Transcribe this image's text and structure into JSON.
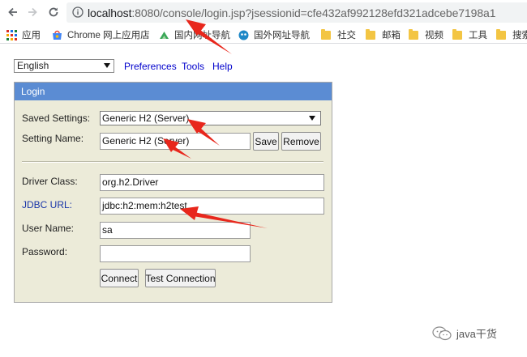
{
  "browser": {
    "url_host": "localhost",
    "url_rest": ":8080/console/login.jsp?jsessionid=cfe432af992128efd321adcebe7198a1",
    "bookmarks": [
      {
        "label": "应用",
        "icon": "apps-grid-icon"
      },
      {
        "label": "Chrome 网上应用店",
        "icon": "chrome-webstore-icon"
      },
      {
        "label": "国内网址导航",
        "icon": "navigation-site-icon"
      },
      {
        "label": "国外网址导航",
        "icon": "globe-site-icon"
      },
      {
        "label": "社交",
        "icon": "folder-icon"
      },
      {
        "label": "邮箱",
        "icon": "folder-icon"
      },
      {
        "label": "视频",
        "icon": "folder-icon"
      },
      {
        "label": "工具",
        "icon": "folder-icon"
      },
      {
        "label": "搜索",
        "icon": "folder-icon"
      }
    ]
  },
  "top": {
    "language": "English",
    "links": [
      "Preferences",
      "Tools",
      "Help"
    ]
  },
  "login": {
    "title": "Login",
    "saved_settings_label": "Saved Settings:",
    "saved_settings_value": "Generic H2 (Server)",
    "setting_name_label": "Setting Name:",
    "setting_name_value": "Generic H2 (Server)",
    "save_button": "Save",
    "remove_button": "Remove",
    "driver_class_label": "Driver Class:",
    "driver_class_value": "org.h2.Driver",
    "jdbc_url_label": "JDBC URL:",
    "jdbc_url_value": "jdbc:h2:mem:h2test",
    "user_name_label": "User Name:",
    "user_name_value": "sa",
    "password_label": "Password:",
    "password_value": "",
    "connect_button": "Connect",
    "test_connection_button": "Test Connection"
  },
  "watermark": {
    "text": "java干货",
    "icon": "wechat-icon"
  },
  "colors": {
    "login_header": "#5b8cd3",
    "login_panel": "#ecebd9",
    "link": "#0000cc",
    "annotation_arrow": "#e8271c"
  }
}
